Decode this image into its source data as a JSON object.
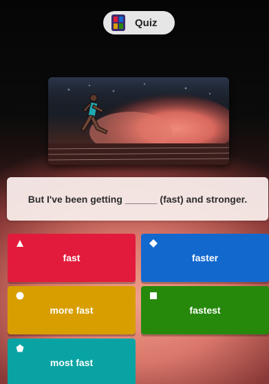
{
  "header": {
    "title": "Quiz",
    "icon": "quiz-app-icon"
  },
  "media": {
    "description_icon": "sprinter-image"
  },
  "question": {
    "text": "But I've been getting ______ (fast) and stronger."
  },
  "answers": [
    {
      "label": "fast",
      "shape": "triangle",
      "color": "#e21b3c"
    },
    {
      "label": "faster",
      "shape": "diamond",
      "color": "#1368ce"
    },
    {
      "label": "more fast",
      "shape": "circle",
      "color": "#d89e00"
    },
    {
      "label": "fastest",
      "shape": "square",
      "color": "#26890c"
    },
    {
      "label": "most fast",
      "shape": "pentagon",
      "color": "#0aa3a3"
    }
  ]
}
